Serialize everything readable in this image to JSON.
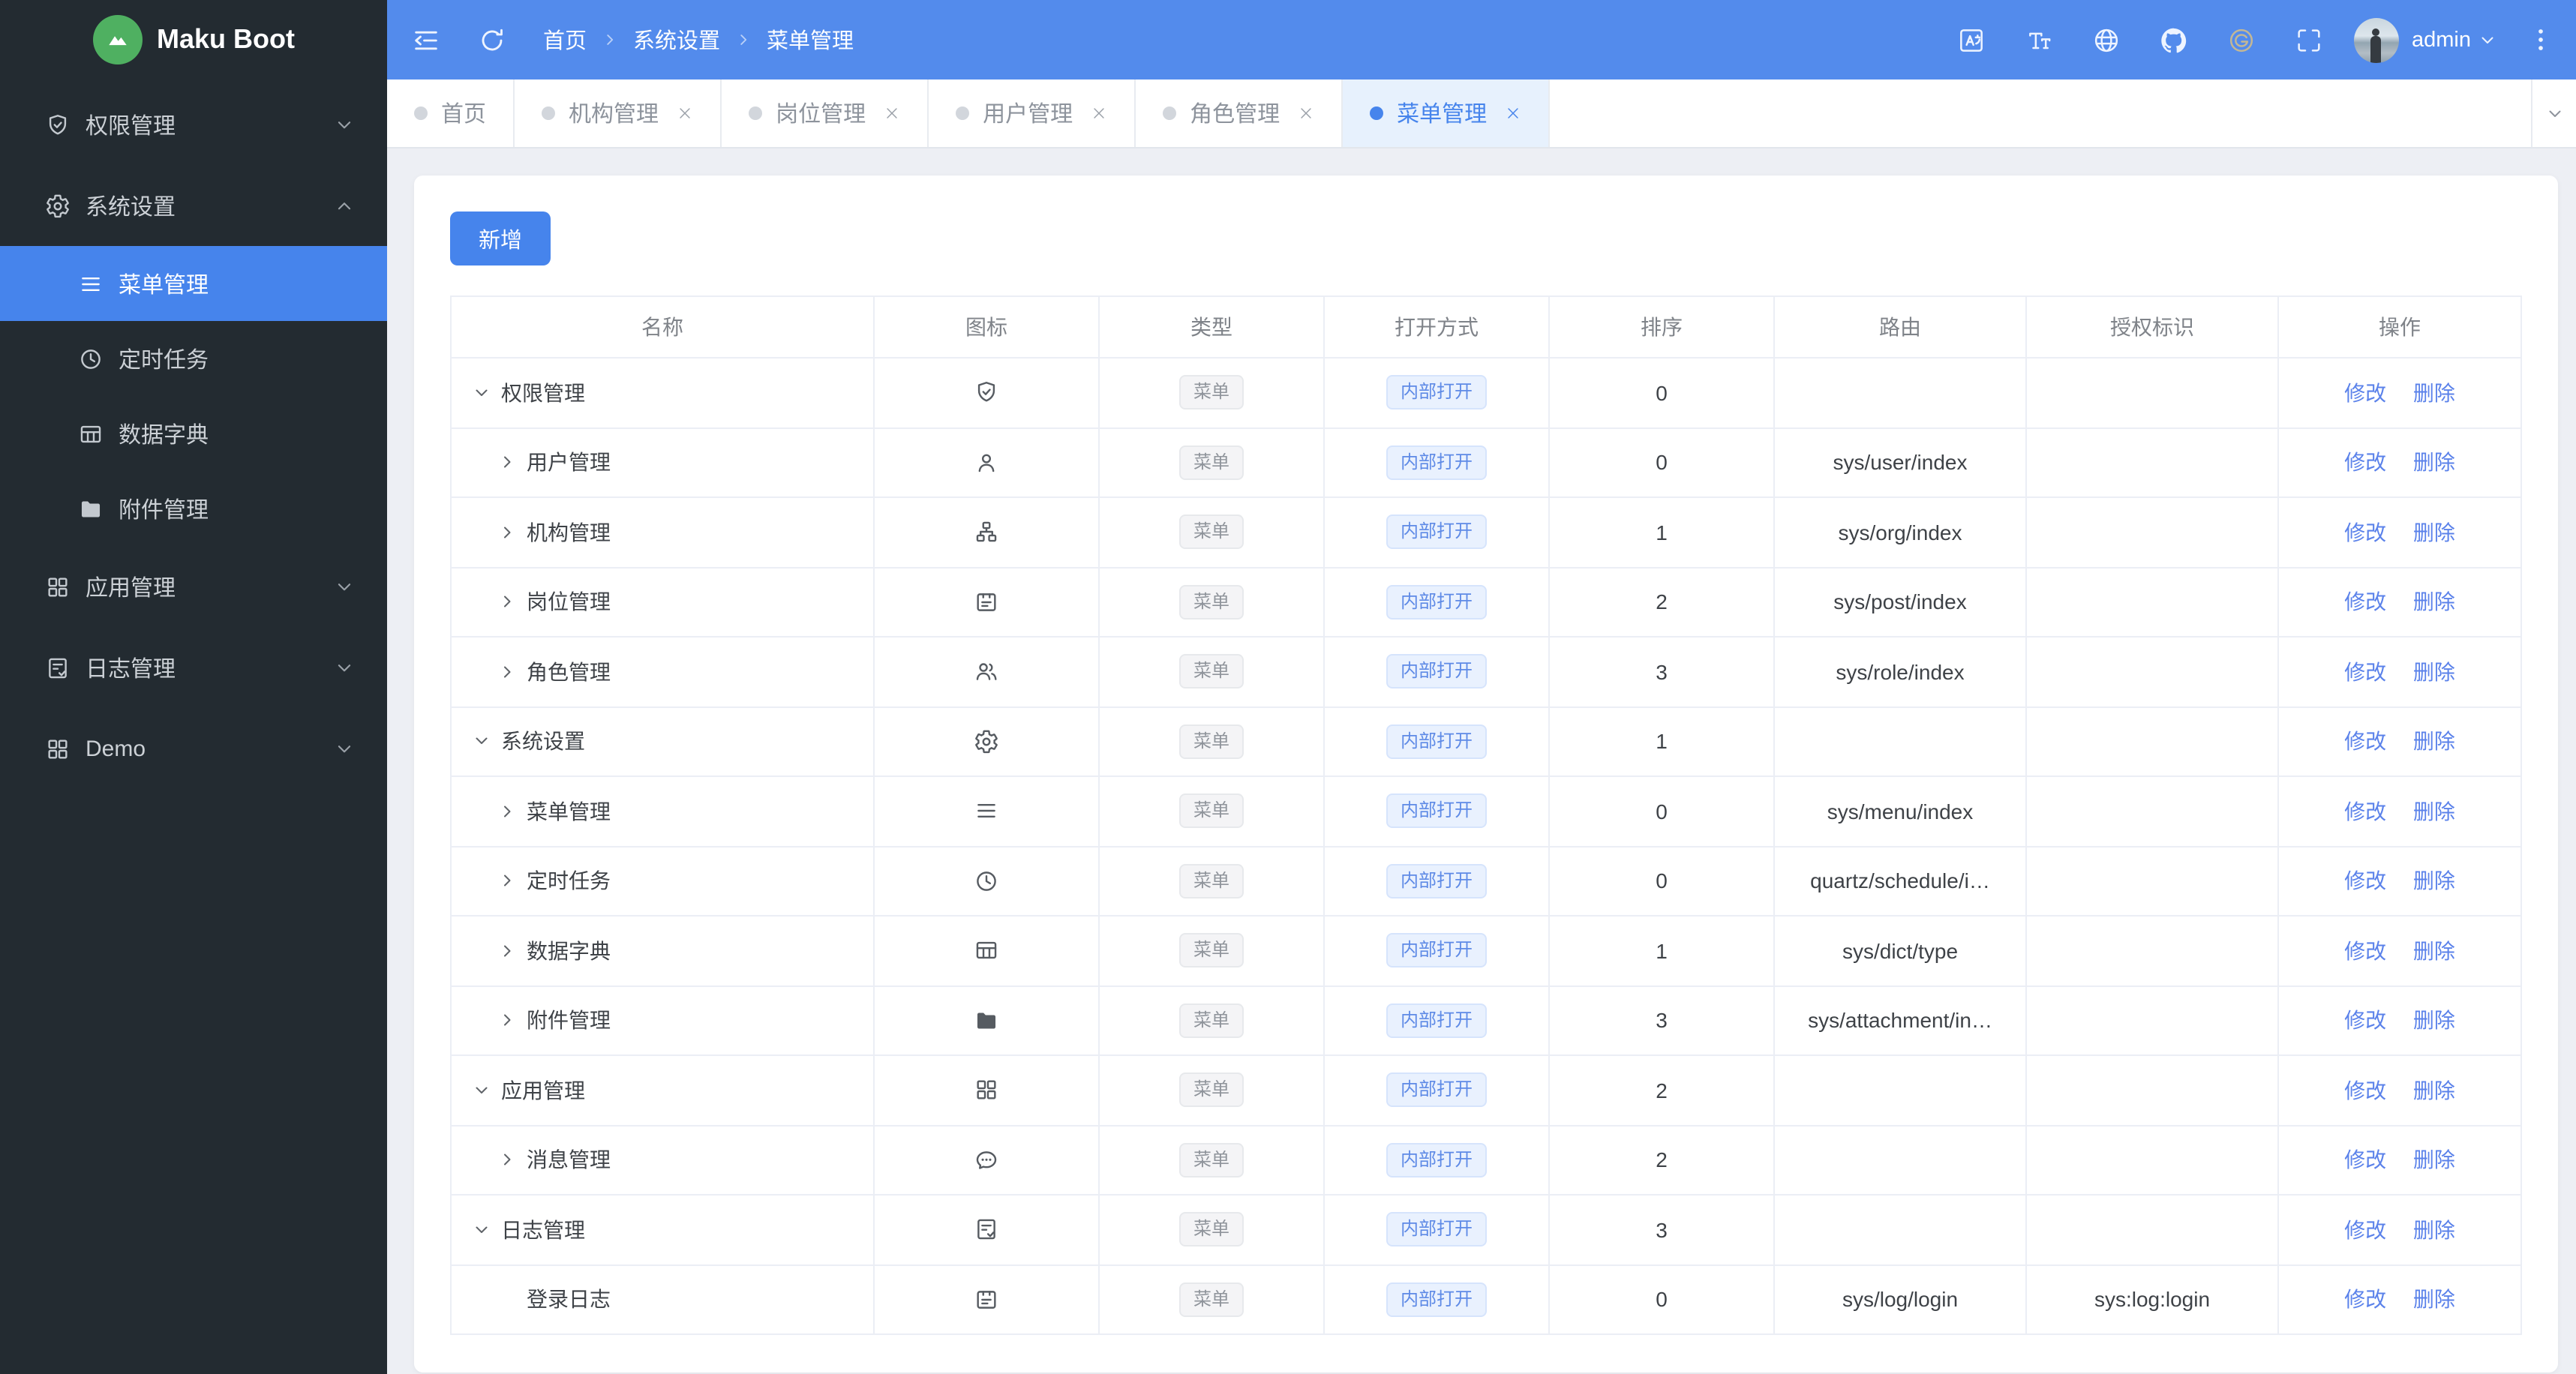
{
  "app": {
    "logo_text": "Maku Boot"
  },
  "sidebar": {
    "items": [
      {
        "key": "permission",
        "label": "权限管理",
        "icon": "shield-check",
        "chevron": "down",
        "level": 0
      },
      {
        "key": "system",
        "label": "系统设置",
        "icon": "gear",
        "chevron": "up",
        "level": 0
      },
      {
        "key": "menu",
        "label": "菜单管理",
        "icon": "menu-lines",
        "level": 1,
        "active": true
      },
      {
        "key": "schedule",
        "label": "定时任务",
        "icon": "clock",
        "level": 1
      },
      {
        "key": "dict",
        "label": "数据字典",
        "icon": "table-grid",
        "level": 1
      },
      {
        "key": "attachment",
        "label": "附件管理",
        "icon": "folder",
        "level": 1
      },
      {
        "key": "app",
        "label": "应用管理",
        "icon": "app-grid",
        "chevron": "down",
        "level": 0
      },
      {
        "key": "log",
        "label": "日志管理",
        "icon": "doc-check",
        "chevron": "down",
        "level": 0
      },
      {
        "key": "demo",
        "label": "Demo",
        "icon": "app-grid",
        "chevron": "down",
        "level": 0
      }
    ]
  },
  "header": {
    "breadcrumb": [
      "首页",
      "系统设置",
      "菜单管理"
    ],
    "user": "admin",
    "icons": [
      "translate-icon",
      "font-size-icon",
      "globe-icon",
      "github-icon",
      "gitee-icon",
      "fullscreen-icon"
    ]
  },
  "tabs": [
    {
      "key": "home",
      "label": "首页",
      "closable": false,
      "active": false
    },
    {
      "key": "org",
      "label": "机构管理",
      "closable": true,
      "active": false
    },
    {
      "key": "post",
      "label": "岗位管理",
      "closable": true,
      "active": false
    },
    {
      "key": "user",
      "label": "用户管理",
      "closable": true,
      "active": false
    },
    {
      "key": "role",
      "label": "角色管理",
      "closable": true,
      "active": false
    },
    {
      "key": "menu",
      "label": "菜单管理",
      "closable": true,
      "active": true
    }
  ],
  "toolbar": {
    "add_label": "新增"
  },
  "table": {
    "columns": [
      "名称",
      "图标",
      "类型",
      "打开方式",
      "排序",
      "路由",
      "授权标识",
      "操作"
    ],
    "type_badge": "菜单",
    "open_badge": "内部打开",
    "actions": {
      "edit": "修改",
      "delete": "删除"
    },
    "rows": [
      {
        "name": "权限管理",
        "icon": "shield-check",
        "expand": "down",
        "level": 0,
        "sort": "0",
        "route": "",
        "perm": ""
      },
      {
        "name": "用户管理",
        "icon": "user",
        "expand": "right",
        "level": 1,
        "sort": "0",
        "route": "sys/user/index",
        "perm": ""
      },
      {
        "name": "机构管理",
        "icon": "org",
        "expand": "right",
        "level": 1,
        "sort": "1",
        "route": "sys/org/index",
        "perm": ""
      },
      {
        "name": "岗位管理",
        "icon": "id-card",
        "expand": "right",
        "level": 1,
        "sort": "2",
        "route": "sys/post/index",
        "perm": ""
      },
      {
        "name": "角色管理",
        "icon": "users",
        "expand": "right",
        "level": 1,
        "sort": "3",
        "route": "sys/role/index",
        "perm": ""
      },
      {
        "name": "系统设置",
        "icon": "gear",
        "expand": "down",
        "level": 0,
        "sort": "1",
        "route": "",
        "perm": ""
      },
      {
        "name": "菜单管理",
        "icon": "menu-lines",
        "expand": "right",
        "level": 1,
        "sort": "0",
        "route": "sys/menu/index",
        "perm": ""
      },
      {
        "name": "定时任务",
        "icon": "clock",
        "expand": "right",
        "level": 1,
        "sort": "0",
        "route": "quartz/schedule/i…",
        "perm": ""
      },
      {
        "name": "数据字典",
        "icon": "table-grid",
        "expand": "right",
        "level": 1,
        "sort": "1",
        "route": "sys/dict/type",
        "perm": ""
      },
      {
        "name": "附件管理",
        "icon": "folder",
        "expand": "right",
        "level": 1,
        "sort": "3",
        "route": "sys/attachment/in…",
        "perm": ""
      },
      {
        "name": "应用管理",
        "icon": "app-grid",
        "expand": "down",
        "level": 0,
        "sort": "2",
        "route": "",
        "perm": ""
      },
      {
        "name": "消息管理",
        "icon": "message",
        "expand": "right",
        "level": 1,
        "sort": "2",
        "route": "",
        "perm": ""
      },
      {
        "name": "日志管理",
        "icon": "doc-check",
        "expand": "down",
        "level": 0,
        "sort": "3",
        "route": "",
        "perm": ""
      },
      {
        "name": "登录日志",
        "icon": "id-card",
        "expand": null,
        "level": 1,
        "sort": "0",
        "route": "sys/log/login",
        "perm": "sys:log:login"
      }
    ]
  },
  "colors": {
    "primary": "#4684ec",
    "header": "#538bec",
    "sidebar_bg": "#232b31",
    "logo_green": "#4fb061",
    "gitee": "#c3b795"
  }
}
